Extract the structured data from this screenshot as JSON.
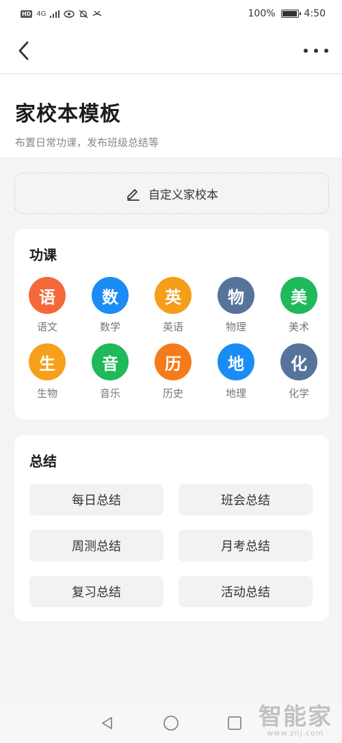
{
  "status_bar": {
    "hd": "HD",
    "network": "4G",
    "battery_text": "100%",
    "battery_level": 1.0,
    "time": "4:50"
  },
  "header": {
    "title": "家校本模板",
    "subtitle": "布置日常功课，发布班级总结等"
  },
  "custom_button": {
    "label": "自定义家校本",
    "icon": "pencil-icon"
  },
  "subjects_section": {
    "title": "功课",
    "items": [
      {
        "char": "语",
        "label": "语文",
        "color": "#f4683a"
      },
      {
        "char": "数",
        "label": "数学",
        "color": "#1a8cf4"
      },
      {
        "char": "英",
        "label": "英语",
        "color": "#f59e1a"
      },
      {
        "char": "物",
        "label": "物理",
        "color": "#56739b"
      },
      {
        "char": "美",
        "label": "美术",
        "color": "#1fb85a"
      },
      {
        "char": "生",
        "label": "生物",
        "color": "#f5a01a"
      },
      {
        "char": "音",
        "label": "音乐",
        "color": "#1fb85a"
      },
      {
        "char": "历",
        "label": "历史",
        "color": "#f57a1a"
      },
      {
        "char": "地",
        "label": "地理",
        "color": "#1a8cf4"
      },
      {
        "char": "化",
        "label": "化学",
        "color": "#56739b"
      }
    ]
  },
  "summary_section": {
    "title": "总结",
    "items": [
      "每日总结",
      "班会总结",
      "周测总结",
      "月考总结",
      "复习总结",
      "活动总结"
    ]
  },
  "watermark": {
    "main": "智能家",
    "sub": "www.znj.com"
  }
}
